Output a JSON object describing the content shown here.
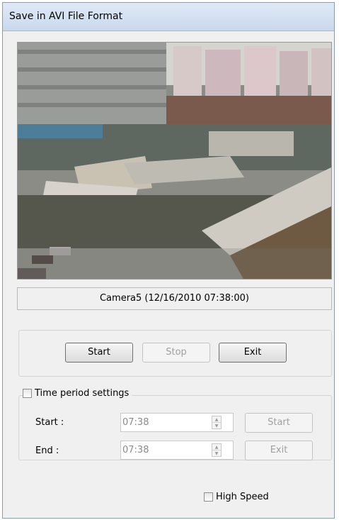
{
  "window": {
    "title": "Save in AVI File Format"
  },
  "video": {
    "caption": "Camera5 (12/16/2010  07:38:00)"
  },
  "controls": {
    "start_label": "Start",
    "stop_label": "Stop",
    "exit_label": "Exit"
  },
  "time_period": {
    "label": "Time period settings",
    "start_label": "Start :",
    "end_label": "End :",
    "start_value": "07:38",
    "end_value": "07:38",
    "start_button": "Start",
    "exit_button": "Exit"
  },
  "high_speed": {
    "label": "High Speed"
  }
}
